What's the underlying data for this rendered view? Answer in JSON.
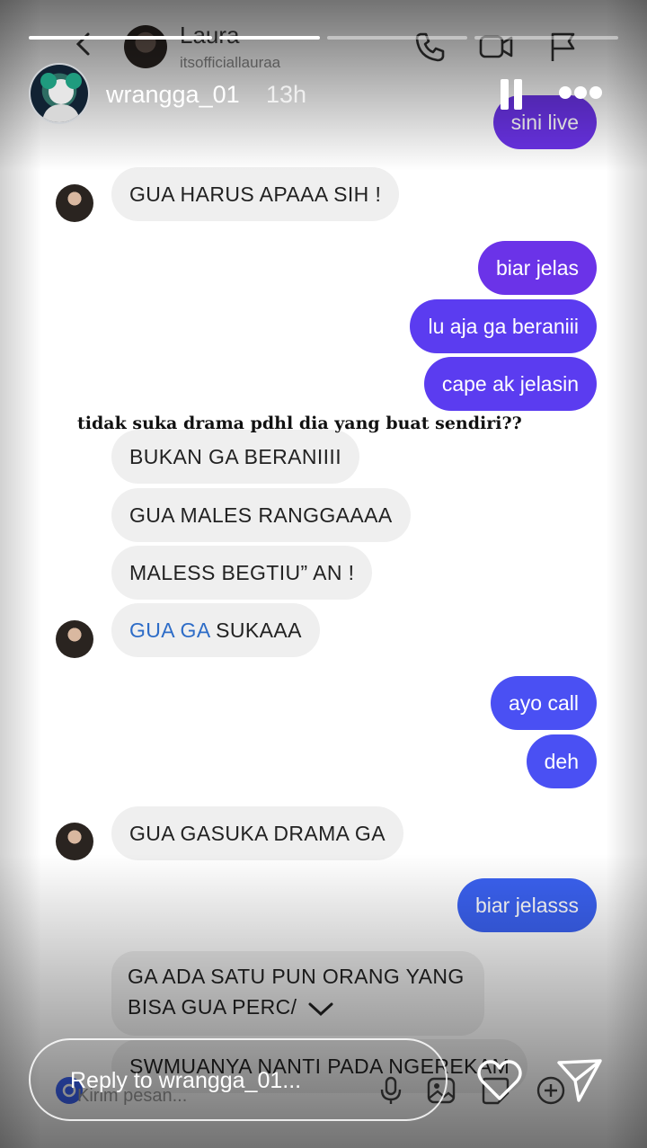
{
  "story": {
    "username": "wrangga_01",
    "time": "13h",
    "reply_placeholder": "Reply to wrangga_01...",
    "progress": [
      1.0,
      1.0,
      0.0,
      0.0
    ]
  },
  "dm": {
    "contact_name": "Laura",
    "contact_username": "itsofficiallauraa",
    "input_placeholder": "Kirim pesan..."
  },
  "caption": "tidak suka drama pdhl dia yang buat sendiri??",
  "messages": [
    {
      "dir": "out",
      "text": "sini live"
    },
    {
      "dir": "in",
      "text": "GUA HARUS APAAA SIH !"
    },
    {
      "dir": "out",
      "text": "biar jelas"
    },
    {
      "dir": "out",
      "text": "lu aja ga beraniii"
    },
    {
      "dir": "out",
      "text": "cape ak jelasin"
    },
    {
      "dir": "in",
      "text": "BUKAN GA BERANIIII"
    },
    {
      "dir": "in",
      "text": "GUA MALES RANGGAAAA"
    },
    {
      "dir": "in",
      "text": "MALESS BEGTIU” AN !"
    },
    {
      "dir": "in",
      "text_highlight": "GUA GA",
      "text_rest": " SUKAAA"
    },
    {
      "dir": "out",
      "text": "ayo call"
    },
    {
      "dir": "out",
      "text": "deh"
    },
    {
      "dir": "in",
      "text": "GUA GASUKA DRAMA GA"
    },
    {
      "dir": "out",
      "text": "biar jelasss"
    },
    {
      "dir": "in",
      "line1": "GA ADA SATU PUN ORANG YANG",
      "line2": "BISA GUA PERC/"
    },
    {
      "dir": "in",
      "text": "SWMUANYA NANTI PADA NGEREKAM"
    }
  ],
  "icons": {
    "dm_back": "chevron-left-icon",
    "dm_phone": "phone-icon",
    "dm_video": "video-camera-icon",
    "dm_flag": "flag-icon",
    "story_pause": "pause-icon",
    "story_more": "more-dots-icon",
    "reply_heart": "heart-icon",
    "reply_send": "send-icon"
  },
  "colors": {
    "bubble_out_top": "#6b33e8",
    "bubble_out_bottom": "#3b62f2",
    "bubble_in": "#efefef",
    "highlight_text": "#2d6cc7"
  }
}
